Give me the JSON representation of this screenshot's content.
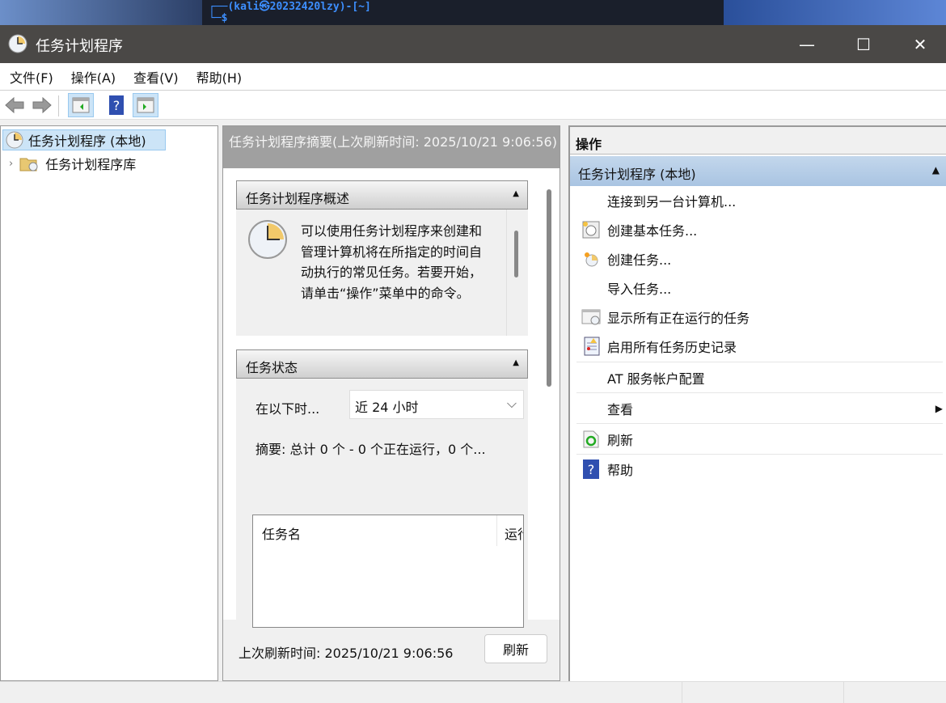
{
  "desktop": {
    "terminal_prompt": "┌──(kali㉿20232420lzy)-[~]",
    "terminal_line2": "└─$"
  },
  "window": {
    "title": "任务计划程序",
    "icon": "clock-icon"
  },
  "menu": [
    "文件(F)",
    "操作(A)",
    "查看(V)",
    "帮助(H)"
  ],
  "toolbar": [
    "back-arrow-icon",
    "forward-arrow-icon",
    "show-hide-console-tree-icon",
    "help-icon",
    "show-hide-action-pane-icon"
  ],
  "tree": {
    "root": "任务计划程序 (本地)",
    "child": "任务计划程序库"
  },
  "middle": {
    "header": "任务计划程序摘要(上次刷新时间: 2025/10/21 9:06:56)",
    "overview_title": "任务计划程序概述",
    "overview_text": "可以使用任务计划程序来创建和管理计算机将在所指定的时间自动执行的常见任务。若要开始，请单击“操作”菜单中的命令。",
    "status_title": "任务状态",
    "period_label": "在以下时...",
    "period_value": "近 24 小时",
    "summary": "摘要: 总计 0 个 - 0 个正在运行，0 个...",
    "columns": [
      "任务名",
      "运行"
    ],
    "last_refresh": "上次刷新时间: 2025/10/21 9:06:56",
    "refresh_button": "刷新"
  },
  "actions": {
    "title": "操作",
    "group": "任务计划程序 (本地)",
    "items": [
      {
        "label": "连接到另一台计算机...",
        "icon": ""
      },
      {
        "label": "创建基本任务...",
        "icon": "create-basic-task-icon"
      },
      {
        "label": "创建任务...",
        "icon": "create-task-icon"
      },
      {
        "label": "导入任务...",
        "icon": ""
      },
      {
        "label": "显示所有正在运行的任务",
        "icon": "running-tasks-icon"
      },
      {
        "label": "启用所有任务历史记录",
        "icon": "task-history-icon"
      },
      {
        "label": "AT 服务帐户配置",
        "icon": ""
      },
      {
        "label": "查看",
        "icon": ""
      },
      {
        "label": "刷新",
        "icon": "refresh-icon"
      },
      {
        "label": "帮助",
        "icon": "help-icon"
      }
    ]
  }
}
